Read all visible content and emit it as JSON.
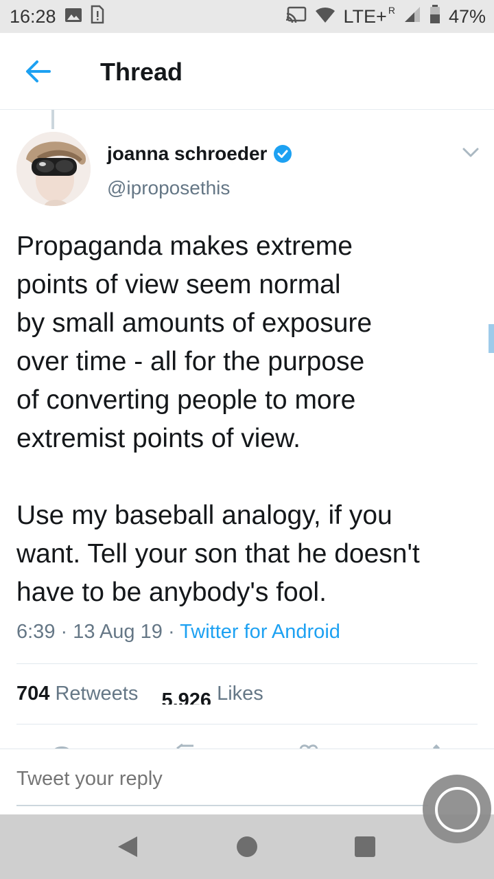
{
  "status_bar": {
    "time": "16:28",
    "network": "LTE+",
    "roaming": "R",
    "battery": "47%",
    "icons": [
      "image-icon",
      "sim-alert-icon",
      "cast-icon",
      "wifi-icon",
      "signal-icon",
      "battery-icon"
    ]
  },
  "app_bar": {
    "title": "Thread",
    "back_icon": "back-arrow-icon"
  },
  "tweet": {
    "author_name": "joanna schroeder",
    "handle": "@iproposethis",
    "verified": true,
    "text": "Propaganda makes extreme\npoints of view seem normal\nby small amounts of exposure\nover time - all for the purpose\nof converting people to more\nextremist points of view.\n\nUse my baseball analogy, if you\nwant. Tell your son that he doesn't\nhave to be anybody's fool.",
    "time": "6:39",
    "separator": "·",
    "date": "13 Aug 19",
    "source": "Twitter for Android",
    "retweets_count": "704",
    "retweets_label": "Retweets",
    "likes_count": "5,926",
    "likes_label": "Likes"
  },
  "reply": {
    "placeholder": "Tweet your reply"
  },
  "colors": {
    "accent": "#1da1f2",
    "secondary_text": "#657786",
    "primary_text": "#14171a"
  }
}
